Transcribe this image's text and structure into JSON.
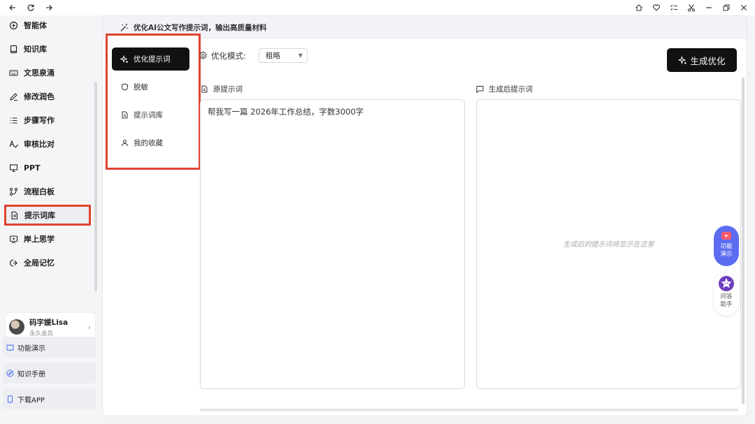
{
  "titlebar": {
    "nav": [
      {
        "name": "back-arrow-icon",
        "glyph": "←"
      },
      {
        "name": "refresh-icon",
        "glyph": "↻"
      },
      {
        "name": "forward-arrow-icon",
        "glyph": "→"
      }
    ],
    "right": [
      {
        "name": "home-icon"
      },
      {
        "name": "heart-icon"
      },
      {
        "name": "checklist-icon"
      },
      {
        "name": "scissors-icon"
      },
      {
        "name": "minimize-icon"
      },
      {
        "name": "restore-icon"
      },
      {
        "name": "close-icon"
      }
    ]
  },
  "sidebar": {
    "items": [
      {
        "label": "智能体",
        "icon": "agent-icon"
      },
      {
        "label": "知识库",
        "icon": "book-icon"
      },
      {
        "label": "文思泉涌",
        "icon": "keyboard-icon"
      },
      {
        "label": "修改润色",
        "icon": "pen-icon"
      },
      {
        "label": "步骤写作",
        "icon": "list-icon"
      },
      {
        "label": "审核比对",
        "icon": "check-text-icon"
      },
      {
        "label": "PPT",
        "icon": "presentation-icon"
      },
      {
        "label": "流程白板",
        "icon": "flow-icon"
      },
      {
        "label": "提示词库",
        "icon": "document-icon",
        "active": true
      },
      {
        "label": "岸上思学",
        "icon": "video-icon"
      },
      {
        "label": "全局记忆",
        "icon": "memory-icon"
      }
    ],
    "user": {
      "name": "码字媛Lisa",
      "role": "永久会员"
    },
    "bottom_links": [
      {
        "label": "功能演示",
        "icon": "book-open-icon"
      },
      {
        "label": "知识手册",
        "icon": "compass-icon"
      },
      {
        "label": "下载APP",
        "icon": "phone-icon"
      }
    ]
  },
  "banner": {
    "text": "优化AI公文写作提示词，输出高质量材料"
  },
  "submenu": {
    "items": [
      {
        "label": "优化提示词",
        "icon": "sparkle-icon",
        "active": true
      },
      {
        "label": "脱敏",
        "icon": "shield-icon"
      },
      {
        "label": "提示词库",
        "icon": "file-icon"
      },
      {
        "label": "我的收藏",
        "icon": "user-icon"
      }
    ]
  },
  "mode": {
    "label": "优化模式:",
    "value": "粗略"
  },
  "generate_button": "生成优化",
  "original": {
    "label": "原提示词",
    "text": "帮我写一篇 2026年工作总结，字数3000字"
  },
  "result": {
    "label": "生成后提示词",
    "placeholder": "生成后的提示词将显示在这里"
  },
  "floating": {
    "demo": {
      "line1": "功能",
      "line2": "演示"
    },
    "qa": {
      "line1": "问答",
      "line2": "助手"
    }
  },
  "colors": {
    "accent": "#5b6cf0",
    "highlight_border": "#e0432f",
    "button_dark": "#111111"
  }
}
